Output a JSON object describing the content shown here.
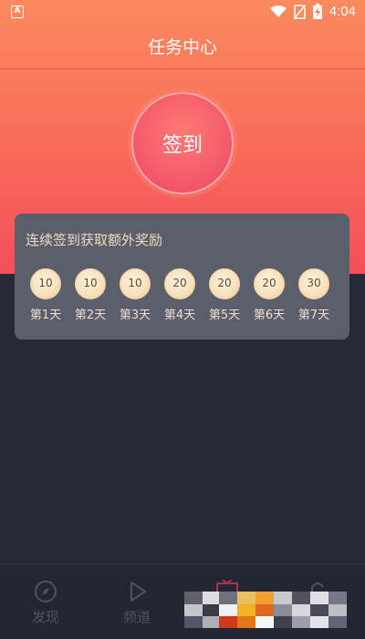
{
  "status_bar": {
    "left_icon": "A",
    "time": "4:04",
    "icons": [
      "wifi-icon",
      "no-sim-icon",
      "battery-charging-icon"
    ]
  },
  "header": {
    "title": "任务中心"
  },
  "signin": {
    "button_label": "签到"
  },
  "bonus_card": {
    "title": "连续签到获取额外奖励",
    "days": [
      {
        "reward": "10",
        "label": "第1天"
      },
      {
        "reward": "10",
        "label": "第2天"
      },
      {
        "reward": "10",
        "label": "第3天"
      },
      {
        "reward": "20",
        "label": "第4天"
      },
      {
        "reward": "20",
        "label": "第5天"
      },
      {
        "reward": "20",
        "label": "第6天"
      },
      {
        "reward": "30",
        "label": "第7天"
      }
    ]
  },
  "bottom_nav": {
    "items": [
      {
        "label": "发现",
        "icon": "compass-icon"
      },
      {
        "label": "频道",
        "icon": "play-icon"
      }
    ]
  },
  "colors": {
    "hero_top": "#fb8a5e",
    "hero_bottom": "#f44f5a",
    "background": "#262a38",
    "card": "#5b5f6b",
    "card_title": "#f3d7c0"
  }
}
